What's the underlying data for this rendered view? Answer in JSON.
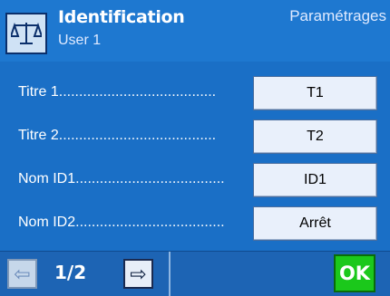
{
  "header": {
    "title": "Identification",
    "subtitle": "User 1",
    "section": "Paramétrages",
    "scale_icon": "balance-scale-icon"
  },
  "rows": [
    {
      "label": "Titre 1.......................................",
      "value": "T1"
    },
    {
      "label": "Titre 2.......................................",
      "value": "T2"
    },
    {
      "label": "Nom ID1.....................................",
      "value": "ID1"
    },
    {
      "label": "Nom ID2.....................................",
      "value": "Arrêt"
    }
  ],
  "footer": {
    "prev_icon": "arrow-left-icon",
    "page": "1/2",
    "next_icon": "arrow-right-icon",
    "ok_label": "OK"
  },
  "colors": {
    "background": "#1a6fc6",
    "ok": "#1bc81b"
  }
}
